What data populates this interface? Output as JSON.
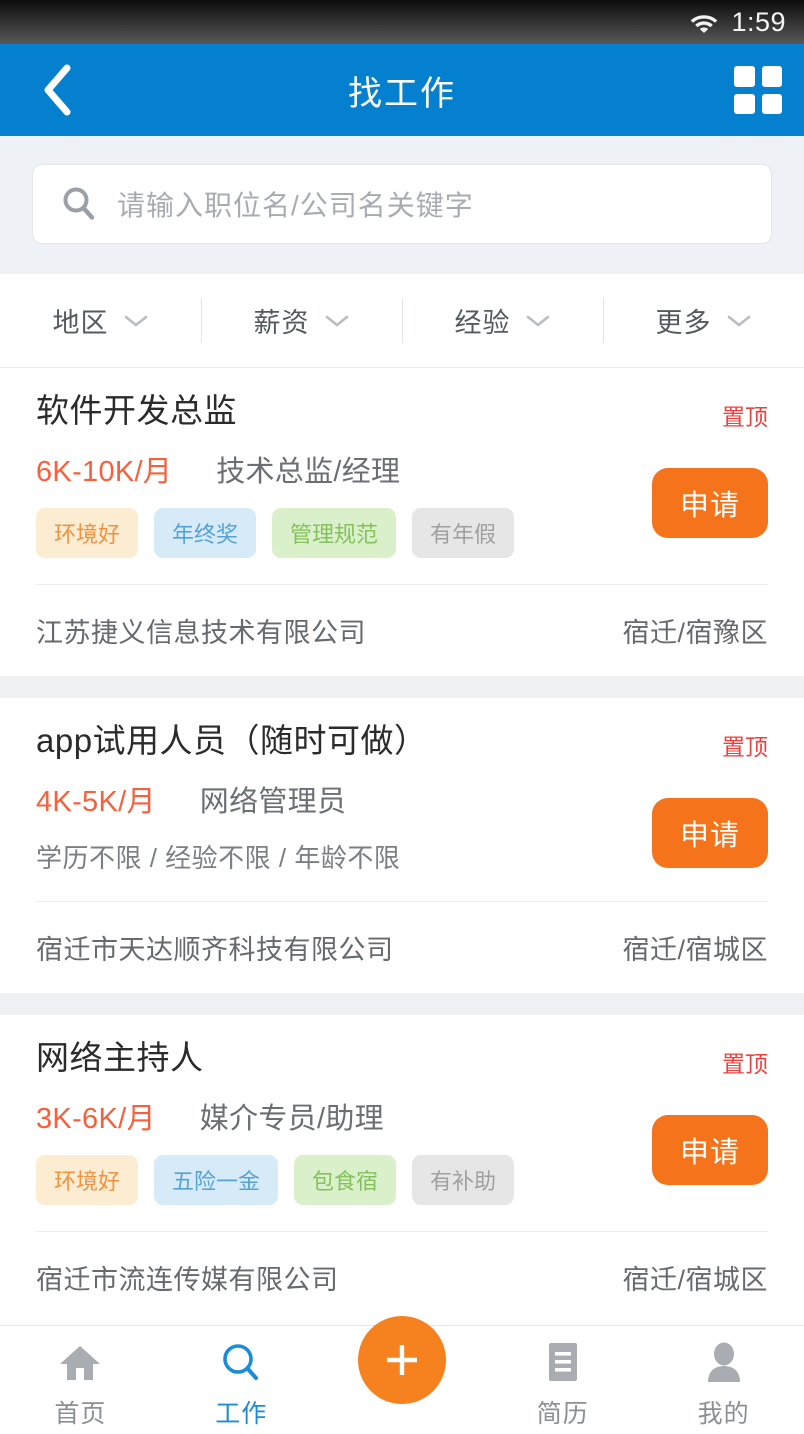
{
  "statusbar": {
    "time": "1:59",
    "wifi_icon": "wifi-icon"
  },
  "header": {
    "title": "找工作",
    "back_icon": "chevron-left-icon",
    "grid_icon": "grid-icon",
    "background_color": "#0580ce"
  },
  "search": {
    "placeholder": "请输入职位名/公司名关键字",
    "value": "",
    "icon": "search-icon"
  },
  "filters": [
    {
      "label": "地区",
      "icon": "chevron-down-icon"
    },
    {
      "label": "薪资",
      "icon": "chevron-down-icon"
    },
    {
      "label": "经验",
      "icon": "chevron-down-icon"
    },
    {
      "label": "更多",
      "icon": "chevron-down-icon"
    }
  ],
  "jobs": [
    {
      "title": "软件开发总监",
      "badge": "置顶",
      "salary": "6K-10K/月",
      "category": "技术总监/经理",
      "requirements": "",
      "tags": [
        {
          "label": "环境好",
          "style": "cream"
        },
        {
          "label": "年终奖",
          "style": "blue"
        },
        {
          "label": "管理规范",
          "style": "green"
        },
        {
          "label": "有年假",
          "style": "gray"
        }
      ],
      "apply_label": "申请",
      "company": "江苏捷义信息技术有限公司",
      "location": "宿迁/宿豫区"
    },
    {
      "title": "app试用人员（随时可做）",
      "badge": "置顶",
      "salary": "4K-5K/月",
      "category": "网络管理员",
      "requirements": "学历不限 / 经验不限 / 年龄不限",
      "tags": [],
      "apply_label": "申请",
      "company": "宿迁市天达顺齐科技有限公司",
      "location": "宿迁/宿城区"
    },
    {
      "title": "网络主持人",
      "badge": "置顶",
      "salary": "3K-6K/月",
      "category": "媒介专员/助理",
      "requirements": "",
      "tags": [
        {
          "label": "环境好",
          "style": "cream"
        },
        {
          "label": "五险一金",
          "style": "blue"
        },
        {
          "label": "包食宿",
          "style": "green"
        },
        {
          "label": "有补助",
          "style": "gray"
        }
      ],
      "apply_label": "申请",
      "company": "宿迁市流连传媒有限公司",
      "location": "宿迁/宿城区"
    }
  ],
  "bottomnav": {
    "items": [
      {
        "label": "首页",
        "icon": "home-icon",
        "active": false
      },
      {
        "label": "工作",
        "icon": "search-icon",
        "active": true
      },
      {
        "label": "简历",
        "icon": "document-icon",
        "active": false
      },
      {
        "label": "我的",
        "icon": "person-icon",
        "active": false
      }
    ],
    "fab_icon": "plus-icon",
    "active_color": "#1a8cd8",
    "fab_color": "#f6821f"
  },
  "colors": {
    "accent_blue": "#0580ce",
    "accent_orange": "#f4731b",
    "salary_red": "#f4613c",
    "badge_red": "#ea4240",
    "page_bg": "#eef1f5"
  }
}
